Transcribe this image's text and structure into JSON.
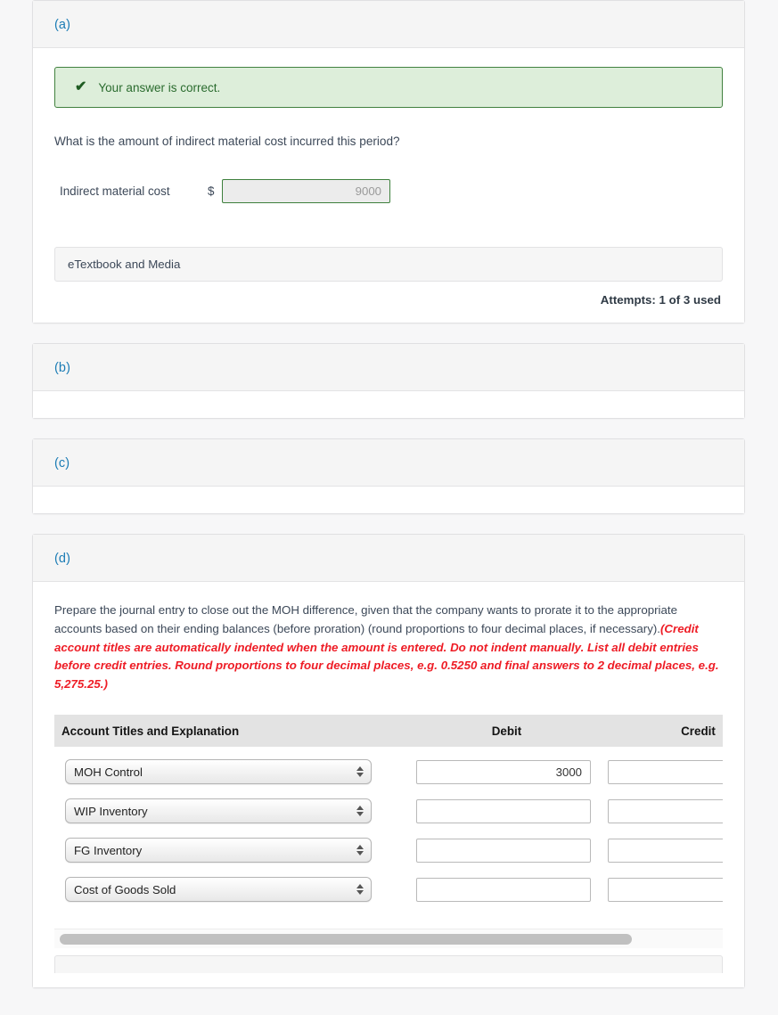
{
  "parts": {
    "a": {
      "label": "(a)",
      "alert": {
        "icon": "check-icon",
        "text": "Your answer is correct.",
        "bg": "#ddeeda",
        "border": "#41813f",
        "color": "#2a6b2e"
      },
      "question": "What is the amount of indirect material cost incurred this period?",
      "answer_label": "Indirect material cost",
      "currency": "$",
      "answer_value": "9000",
      "answer_placeholder": "",
      "etextbook_label": "eTextbook and Media",
      "attempts": "Attempts: 1 of 3 used"
    },
    "b": {
      "label": "(b)"
    },
    "c": {
      "label": "(c)"
    },
    "d": {
      "label": "(d)",
      "instructions_plain": "Prepare the journal entry to close out the MOH difference, given that the company wants to prorate it to the appropriate accounts based on their ending balances (before proration) (round proportions to four decimal places, if necessary).",
      "instructions_emph": "(Credit account titles are automatically indented when the amount is entered. Do not indent manually. List all debit entries before credit entries. Round proportions to four decimal places, e.g. 0.5250 and final answers to 2 decimal places, e.g. 5,275.25.)",
      "table": {
        "headers": {
          "account": "Account Titles and Explanation",
          "debit": "Debit",
          "credit": "Credit"
        },
        "rows": [
          {
            "account": "MOH Control",
            "debit": "3000",
            "credit": ""
          },
          {
            "account": "WIP Inventory",
            "debit": "",
            "credit": ""
          },
          {
            "account": "FG Inventory",
            "debit": "",
            "credit": ""
          },
          {
            "account": "Cost of Goods Sold",
            "debit": "",
            "credit": ""
          }
        ]
      },
      "scrollbar": {
        "thumb_percent": "87"
      }
    }
  },
  "colors": {
    "part_label": "#1b7cb5",
    "alert_green": "#41813f",
    "instruction_red": "#ee1c25",
    "page_bg": "#f7f7f8"
  }
}
